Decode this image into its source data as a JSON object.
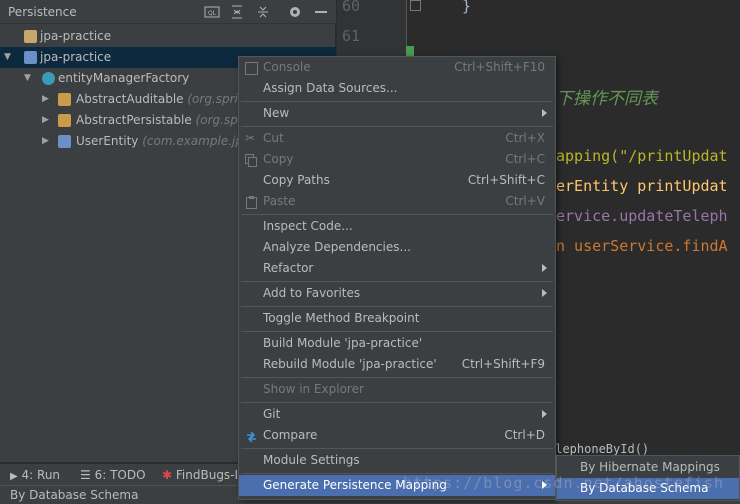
{
  "panel": {
    "title": "Persistence",
    "tree": [
      {
        "label": "jpa-practice",
        "pkg": ""
      },
      {
        "label": "jpa-practice",
        "pkg": ""
      },
      {
        "label": "entityManagerFactory",
        "pkg": ""
      },
      {
        "label": "AbstractAuditable",
        "pkg": "(org.sprin"
      },
      {
        "label": "AbstractPersistable",
        "pkg": "(org.spr"
      },
      {
        "label": "UserEntity",
        "pkg": "(com.example.jpa"
      }
    ]
  },
  "editor": {
    "line_numbers": [
      "60",
      "61"
    ],
    "code_lines": [
      {
        "text": "}",
        "color": "#a9b7c6"
      },
      {
        "text": "下操作不同表",
        "color": "#629755"
      },
      {
        "text": "apping(\"/printUpdat",
        "color": "#bbb529"
      },
      {
        "text": "erEntity printUpdat",
        "color": "#ffc66d"
      },
      {
        "text": "ervice.updateTeleph",
        "color": "#9876aa"
      },
      {
        "text": "n userService.findA",
        "color": "#cc7832"
      },
      {
        "text": "elephoneById()",
        "color": "#bbbbbb"
      }
    ]
  },
  "menu": {
    "items": [
      {
        "label": "Console",
        "shortcut": "Ctrl+Shift+F10",
        "disabled": true,
        "submenu": false,
        "icon": "console-icon"
      },
      {
        "label": "Assign Data Sources...",
        "shortcut": "",
        "disabled": false,
        "submenu": false
      },
      {
        "label": "New",
        "shortcut": "",
        "disabled": false,
        "submenu": true
      },
      {
        "label": "Cut",
        "shortcut": "Ctrl+X",
        "disabled": true,
        "submenu": false,
        "icon": "cut-icon"
      },
      {
        "label": "Copy",
        "shortcut": "Ctrl+C",
        "disabled": true,
        "submenu": false,
        "icon": "copy-icon"
      },
      {
        "label": "Copy Paths",
        "shortcut": "Ctrl+Shift+C",
        "disabled": false,
        "submenu": false
      },
      {
        "label": "Paste",
        "shortcut": "Ctrl+V",
        "disabled": true,
        "submenu": false,
        "icon": "paste-icon"
      },
      {
        "label": "Inspect Code...",
        "shortcut": "",
        "disabled": false,
        "submenu": false
      },
      {
        "label": "Analyze Dependencies...",
        "shortcut": "",
        "disabled": false,
        "submenu": false
      },
      {
        "label": "Refactor",
        "shortcut": "",
        "disabled": false,
        "submenu": true
      },
      {
        "label": "Add to Favorites",
        "shortcut": "",
        "disabled": false,
        "submenu": true
      },
      {
        "label": "Toggle Method Breakpoint",
        "shortcut": "",
        "disabled": false,
        "submenu": false
      },
      {
        "label": "Build Module 'jpa-practice'",
        "shortcut": "",
        "disabled": false,
        "submenu": false
      },
      {
        "label": "Rebuild Module 'jpa-practice'",
        "shortcut": "Ctrl+Shift+F9",
        "disabled": false,
        "submenu": false
      },
      {
        "label": "Show in Explorer",
        "shortcut": "",
        "disabled": true,
        "submenu": false
      },
      {
        "label": "Git",
        "shortcut": "",
        "disabled": false,
        "submenu": true
      },
      {
        "label": "Compare",
        "shortcut": "Ctrl+D",
        "disabled": false,
        "submenu": false,
        "icon": "compare-icon"
      },
      {
        "label": "Module Settings",
        "shortcut": "",
        "disabled": false,
        "submenu": false
      },
      {
        "label": "Generate Persistence Mapping",
        "shortcut": "",
        "disabled": false,
        "submenu": true,
        "active": true
      }
    ]
  },
  "submenu": {
    "items": [
      {
        "label": "By Hibernate Mappings"
      },
      {
        "label": "By Database Schema"
      }
    ]
  },
  "bottombar": {
    "run": "4: Run",
    "todo": "6: TODO",
    "findbugs": "FindBugs-IE"
  },
  "statusbar": {
    "text": "By Database Schema"
  },
  "watermark": "https://blog.csdn.net/ahostefish",
  "colors": {
    "accent": "#4b6eaf",
    "selection": "#0d293e",
    "panel_bg": "#3c3f41",
    "editor_bg": "#2b2b2b"
  }
}
